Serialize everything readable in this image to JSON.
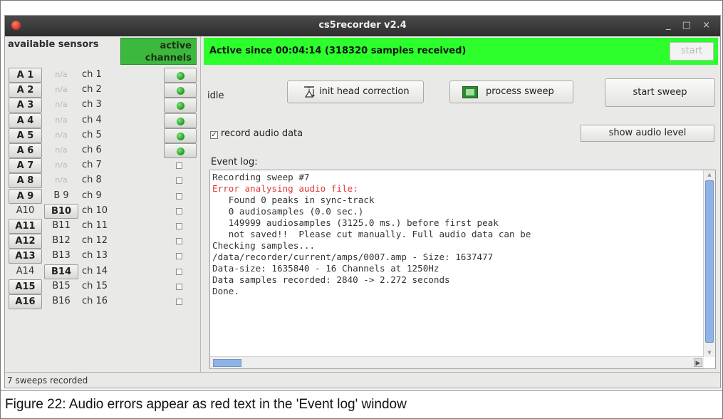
{
  "window": {
    "title": "cs5recorder v2.4",
    "wm_controls": "_ □ ×"
  },
  "left_panel": {
    "available_header": "available sensors",
    "active_header": "active channels",
    "rows": [
      {
        "a": "A 1",
        "b": "n/a",
        "ch": "ch 1",
        "a_state": "button",
        "b_state": "na",
        "active": true
      },
      {
        "a": "A 2",
        "b": "n/a",
        "ch": "ch 2",
        "a_state": "button",
        "b_state": "na",
        "active": true
      },
      {
        "a": "A 3",
        "b": "n/a",
        "ch": "ch 3",
        "a_state": "button",
        "b_state": "na",
        "active": true
      },
      {
        "a": "A 4",
        "b": "n/a",
        "ch": "ch 4",
        "a_state": "button",
        "b_state": "na",
        "active": true
      },
      {
        "a": "A 5",
        "b": "n/a",
        "ch": "ch 5",
        "a_state": "button",
        "b_state": "na",
        "active": true
      },
      {
        "a": "A 6",
        "b": "n/a",
        "ch": "ch 6",
        "a_state": "button",
        "b_state": "na",
        "active": true
      },
      {
        "a": "A 7",
        "b": "n/a",
        "ch": "ch 7",
        "a_state": "button",
        "b_state": "na",
        "active": false
      },
      {
        "a": "A 8",
        "b": "n/a",
        "ch": "ch 8",
        "a_state": "button",
        "b_state": "na",
        "active": false
      },
      {
        "a": "A 9",
        "b": "B 9",
        "ch": "ch 9",
        "a_state": "button",
        "b_state": "plain",
        "active": false
      },
      {
        "a": "A10",
        "b": "B10",
        "ch": "ch 10",
        "a_state": "plain",
        "b_state": "button",
        "active": false
      },
      {
        "a": "A11",
        "b": "B11",
        "ch": "ch 11",
        "a_state": "button",
        "b_state": "plain",
        "active": false
      },
      {
        "a": "A12",
        "b": "B12",
        "ch": "ch 12",
        "a_state": "button",
        "b_state": "plain",
        "active": false
      },
      {
        "a": "A13",
        "b": "B13",
        "ch": "ch 13",
        "a_state": "button",
        "b_state": "plain",
        "active": false
      },
      {
        "a": "A14",
        "b": "B14",
        "ch": "ch 14",
        "a_state": "plain",
        "b_state": "button",
        "active": false
      },
      {
        "a": "A15",
        "b": "B15",
        "ch": "ch 15",
        "a_state": "button",
        "b_state": "plain",
        "active": false
      },
      {
        "a": "A16",
        "b": "B16",
        "ch": "ch 16",
        "a_state": "button",
        "b_state": "plain",
        "active": false
      }
    ]
  },
  "status_bar": "7 sweeps recorded",
  "banner": {
    "text": "Active since 00:04:14 (318320 samples received)",
    "start_label": "start",
    "color": "#2cff2c"
  },
  "controls": {
    "state": "idle",
    "init_label": "init head correction",
    "process_label": "process sweep",
    "sweep_label": "start sweep",
    "record_audio_label": "record audio data",
    "record_audio_checked": true,
    "record_check_mark": "✓",
    "audio_level_label": "show audio level"
  },
  "event_log": {
    "label": "Event log:",
    "lines": [
      {
        "text": "Recording sweep #7",
        "error": false
      },
      {
        "text": "Error analysing audio file:",
        "error": true
      },
      {
        "text": "   Found 0 peaks in sync-track",
        "error": false
      },
      {
        "text": "   0 audiosamples (0.0 sec.)",
        "error": false
      },
      {
        "text": "   149999 audiosamples (3125.0 ms.) before first peak",
        "error": false
      },
      {
        "text": "   not saved!!  Please cut manually. Full audio data can be",
        "error": false
      },
      {
        "text": "Checking samples...",
        "error": false
      },
      {
        "text": "/data/recorder/current/amps/0007.amp - Size: 1637477",
        "error": false
      },
      {
        "text": "Data-size: 1635840 - 16 Channels at 1250Hz",
        "error": false
      },
      {
        "text": "Data samples recorded: 2840 -> 2.272 seconds",
        "error": false
      },
      {
        "text": "Done.",
        "error": false
      }
    ],
    "error_color": "#e23a3a"
  },
  "caption": "Figure 22:  Audio errors appear as red text in the 'Event log' window"
}
